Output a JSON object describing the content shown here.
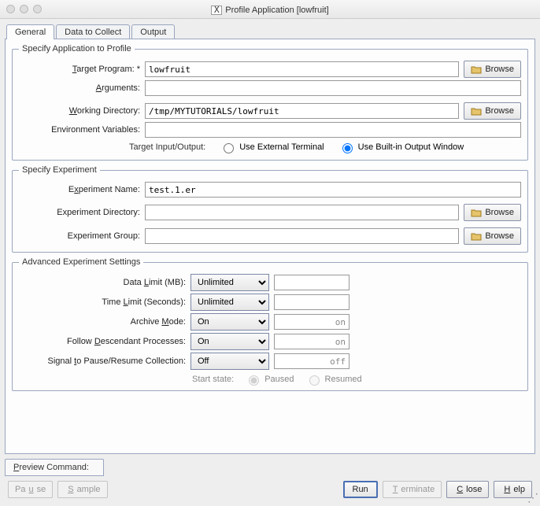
{
  "window": {
    "title": "Profile Application [lowfruit]"
  },
  "tabs": [
    {
      "label": "General",
      "active": true
    },
    {
      "label": "Data to Collect",
      "active": false
    },
    {
      "label": "Output",
      "active": false
    }
  ],
  "specifyApp": {
    "legend": "Specify Application to Profile",
    "targetProgram": {
      "label_pre": "",
      "label_u": "T",
      "label_post": "arget Program: *",
      "value": "lowfruit"
    },
    "arguments": {
      "label_pre": "",
      "label_u": "A",
      "label_post": "rguments:",
      "value": ""
    },
    "workingDir": {
      "label_pre": "",
      "label_u": "W",
      "label_post": "orking Directory:",
      "value": "/tmp/MYTUTORIALS/lowfruit"
    },
    "envVars": {
      "label": "Environment Variables:",
      "value": ""
    },
    "io": {
      "lead": "Target Input/Output:",
      "external": "Use External Terminal",
      "builtin": "Use Built-in Output Window",
      "selected": "builtin"
    },
    "browse": "Browse"
  },
  "specifyExp": {
    "legend": "Specify Experiment",
    "name": {
      "label_pre": "E",
      "label_u": "x",
      "label_post": "periment Name:",
      "value": "test.1.er"
    },
    "dir": {
      "label": "Experiment Directory:",
      "value": ""
    },
    "group": {
      "label": "Experiment Group:",
      "value": ""
    },
    "browse": "Browse"
  },
  "adv": {
    "legend": "Advanced Experiment Settings",
    "dataLimit": {
      "label_pre": "Data ",
      "label_u": "L",
      "label_post": "imit (MB):",
      "value": "Unlimited",
      "aux": ""
    },
    "timeLimit": {
      "label_pre": "Time ",
      "label_u": "L",
      "label_post": "imit (Seconds):",
      "value": "Unlimited",
      "aux": ""
    },
    "archive": {
      "label_pre": "Archive ",
      "label_u": "M",
      "label_post": "ode:",
      "value": "On",
      "aux": "on"
    },
    "follow": {
      "label_pre": "Follow ",
      "label_u": "D",
      "label_post": "escendant Processes:",
      "value": "On",
      "aux": "on"
    },
    "signal": {
      "label_pre": "Signal ",
      "label_u": "t",
      "label_post": "o Pause/Resume Collection:",
      "value": "Off",
      "aux": "off"
    },
    "start": {
      "lead": "Start state:",
      "paused": "Paused",
      "resumed": "Resumed",
      "selected": "paused"
    }
  },
  "preview": {
    "label_pre": "",
    "label_u": "P",
    "label_post": "review Command:"
  },
  "buttons": {
    "pause": {
      "pre": "Pa",
      "u": "u",
      "post": "se"
    },
    "sample": {
      "pre": "",
      "u": "S",
      "post": "ample"
    },
    "run": "Run",
    "terminate": {
      "pre": "",
      "u": "T",
      "post": "erminate"
    },
    "close": {
      "pre": "",
      "u": "C",
      "post": "lose"
    },
    "help": {
      "pre": "",
      "u": "H",
      "post": "elp"
    }
  }
}
